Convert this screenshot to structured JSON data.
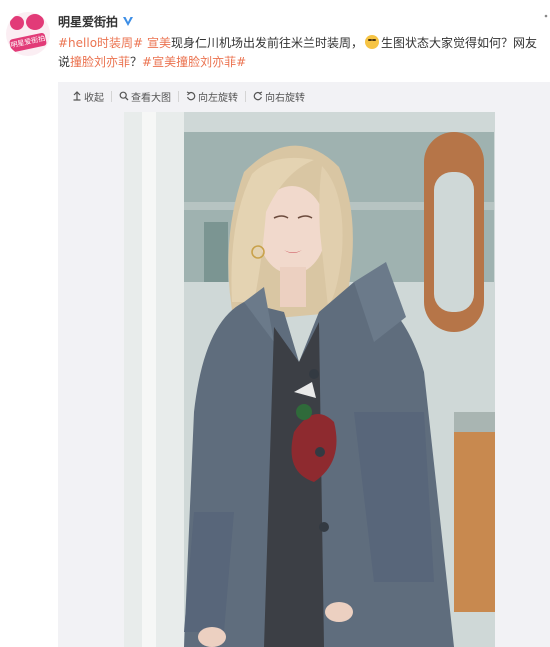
{
  "post": {
    "username": "明星爱街拍",
    "avatar_text": "明星爱街拍",
    "segments": [
      {
        "text": "#hello时装周#",
        "type": "link"
      },
      {
        "text": " ",
        "type": "text"
      },
      {
        "text": "宣美",
        "type": "link"
      },
      {
        "text": "现身仁川机场出发前往米兰时装周，",
        "type": "text"
      },
      {
        "text": "生图状态大家觉得如何？网友说",
        "type": "text"
      },
      {
        "text": "撞脸刘亦菲",
        "type": "link"
      },
      {
        "text": "？",
        "type": "text"
      },
      {
        "text": "#宣美撞脸刘亦菲#",
        "type": "link"
      }
    ]
  },
  "toolbar": {
    "collapse": "收起",
    "view_large": "查看大图",
    "rotate_left": "向左旋转",
    "rotate_right": "向右旋转"
  },
  "colors": {
    "link": "#eb7350",
    "brand": "#e23b78",
    "panel_bg": "#f2f2f5",
    "coat": "#5f6d7d"
  },
  "icons": [
    "vip-v-icon",
    "collapse-arrow-icon",
    "search-icon",
    "rotate-left-icon",
    "rotate-right-icon",
    "emoji-icon",
    "more-dots-icon"
  ]
}
